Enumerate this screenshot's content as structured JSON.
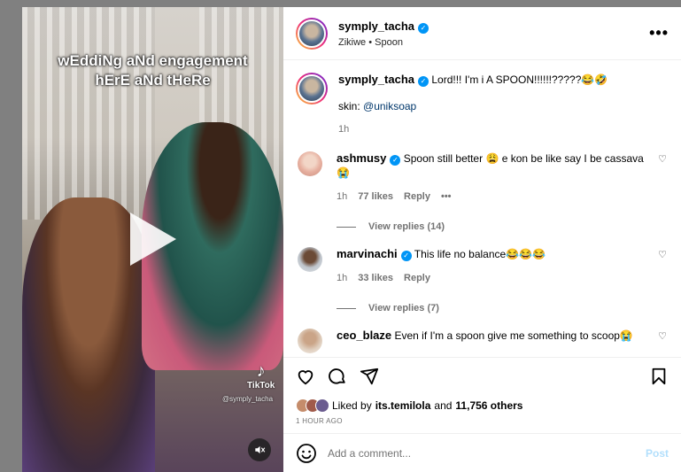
{
  "media": {
    "overlay_caption_line1": "wEddiNg aNd engagement",
    "overlay_caption_line2": "hErE aNd tHeRe",
    "tiktok_label": "TikTok",
    "tiktok_handle": "@symply_tacha",
    "play_icon": "play-icon",
    "mute_icon": "mute-icon"
  },
  "header": {
    "username": "symply_tacha",
    "subline": "Zikiwe • Spoon",
    "more_icon": "•••"
  },
  "caption": {
    "username": "symply_tacha",
    "text": "Lord!!! I'm i A SPOON!!!!!!?????😂🤣",
    "skin_prefix": "skin: ",
    "skin_link": "@uniksoap",
    "time": "1h"
  },
  "comments": [
    {
      "username": "ashmusy",
      "text": "Spoon still better 😩 e kon be like say I be cassava 😭",
      "time": "1h",
      "likes": "77 likes",
      "reply": "Reply",
      "more": "•••",
      "view_replies": "View replies (14)"
    },
    {
      "username": "marvinachi",
      "text": "This life no balance😂😂😂",
      "time": "1h",
      "likes": "33 likes",
      "reply": "Reply",
      "view_replies": "View replies (7)"
    },
    {
      "username": "ceo_blaze",
      "text": "Even if I'm a spoon give me something to scoop😭"
    }
  ],
  "likes": {
    "prefix": "Liked by",
    "user": "its.temilola",
    "conj": "and",
    "others": "11,756 others"
  },
  "timestamp": "1 HOUR AGO",
  "composer": {
    "placeholder": "Add a comment...",
    "post_label": "Post"
  }
}
